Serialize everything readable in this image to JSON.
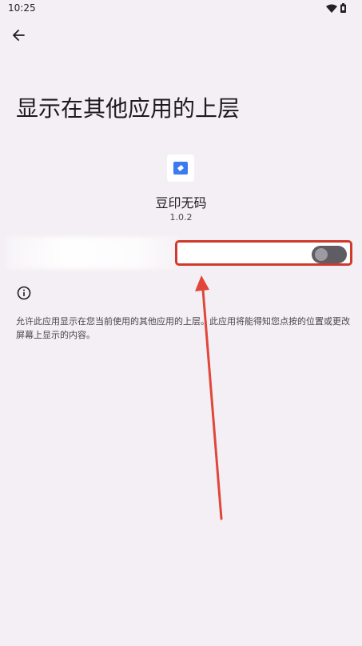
{
  "status_bar": {
    "time": "10:25",
    "icons": [
      "wifi-icon",
      "battery-icon"
    ]
  },
  "header": {
    "back_icon": "arrow-left-icon"
  },
  "page": {
    "title": "显示在其他应用的上层"
  },
  "app": {
    "name": "豆印无码",
    "version": "1.0.2",
    "icon_color": "#3a7bf0"
  },
  "permission": {
    "toggle_state": "off"
  },
  "info": {
    "icon": "info-icon",
    "description": "允许此应用显示在您当前使用的其他应用的上层。此应用将能得知您点按的位置或更改屏幕上显示的内容。"
  },
  "annotation": {
    "highlight_color": "#d1392c",
    "arrow_color": "#e0473a"
  }
}
